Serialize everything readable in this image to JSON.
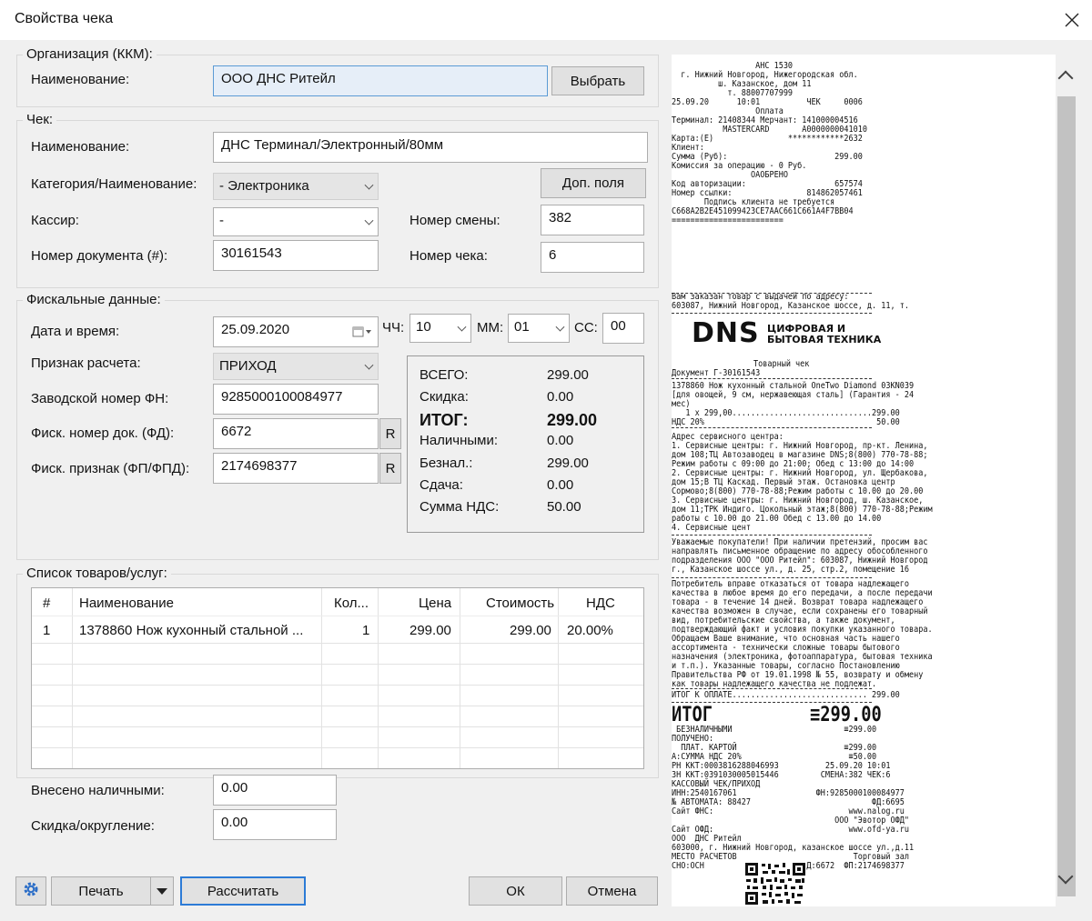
{
  "window": {
    "title": "Свойства чека"
  },
  "kkm": {
    "group_label": "Организация (ККМ):",
    "name_label": "Наименование:",
    "name_value": "ООО  ДНС Ритейл",
    "select_button": "Выбрать"
  },
  "check": {
    "group_label": "Чек:",
    "name_label": "Наименование:",
    "name_value": "ДНС Терминал/Электронный/80мм",
    "category_label": "Категория/Наименование:",
    "category_value": "- Электроника",
    "extra_button": "Доп. поля",
    "cashier_label": "Кассир:",
    "cashier_value": "-",
    "shift_label": "Номер смены:",
    "shift_value": "382",
    "doc_label": "Номер документа (#):",
    "doc_value": "30161543",
    "check_num_label": "Номер чека:",
    "check_num_value": "6"
  },
  "fiscal": {
    "group_label": "Фискальные данные:",
    "date_label": "Дата и время:",
    "date_value": "25.09.2020",
    "hh_label": "ЧЧ:",
    "hh_value": "10",
    "mm_label": "ММ:",
    "mm_value": "01",
    "ss_label": "СС:",
    "ss_value": "00",
    "calc_label": "Признак расчета:",
    "calc_value": "ПРИХОД",
    "fn_label": "Заводской номер ФН:",
    "fn_value": "9285000100084977",
    "fd_label": "Фиск. номер док. (ФД):",
    "fd_value": "6672",
    "fp_label": "Фиск. признак (ФП/ФПД):",
    "fp_value": "2174698377",
    "r_button": "R"
  },
  "totals": {
    "total_label": "ВСЕГО:",
    "total_value": "299.00",
    "discount_label": "Скидка:",
    "discount_value": "0.00",
    "itog_label": "ИТОГ:",
    "itog_value": "299.00",
    "cash_label": "Наличными:",
    "cash_value": "0.00",
    "card_label": "Безнал.:",
    "card_value": "299.00",
    "change_label": "Сдача:",
    "change_value": "0.00",
    "vat_label": "Сумма НДС:",
    "vat_value": "50.00"
  },
  "goods": {
    "group_label": "Список товаров/услуг:",
    "columns": [
      "#",
      "Наименование",
      "Кол...",
      "Цена",
      "Стоимость",
      "НДС"
    ],
    "rows": [
      [
        "1",
        "1378860 Нож кухонный стальной ...",
        "1",
        "299.00",
        "299.00",
        "20.00%"
      ]
    ]
  },
  "bottom": {
    "cash_in_label": "Внесено наличными:",
    "cash_in_value": "0.00",
    "rounding_label": "Скидка/округление:",
    "rounding_value": "0.00",
    "print_button": "Печать",
    "calc_button": "Рассчитать",
    "ok_button": "ОК",
    "cancel_button": "Отмена"
  },
  "receipt": {
    "slip_lines": [
      "                  АНС 1530",
      "  г. Нижний Новгород, Нижегородская обл.",
      "          ш. Казанское, дом 11",
      "            т. 88007707999",
      "25.09.20      10:01          ЧЕК     0006",
      "                  Оплата",
      "Терминал: 21408344 Мерчант: 141000004516",
      "           MASTERCARD       A0000000041010",
      "Карта:(E)                ************2632",
      "Клиент:",
      "Сумма (Руб):                       299.00",
      "Комиссия за операцию - 0 Руб.",
      "                 ОАОБРЕНО",
      "Код авторизации:                   657574",
      "Номер ссылки:                814862057461",
      "       Подпись клиента не требуется",
      "C668A2B2E451099423CE7AAC661C661A4F7BB04",
      "========================"
    ],
    "address_lines": [
      "Вам заказан товар с выдачей по адресу:",
      "603087, Нижний Новгород, Казанское шоссе, д. 11, т."
    ],
    "logo_text": "DNS",
    "logo_sub": [
      "ЦИФРОВАЯ И",
      "БЫТОВАЯ ТЕХНИКА"
    ],
    "check_title": "Товарный чек",
    "doc_line": "Документ Г-30161543",
    "item_lines": [
      "1378860 Нож кухонный стальной OneTwo Diamond 03KN039",
      "[для овощей, 9 см, нержавеющая сталь] (Гарантия - 24",
      "мес)",
      "   1 x 299,00..............................299.00",
      "НДС 20%                                     50.00"
    ],
    "service_lines": [
      "Адрес сервисного центра:",
      "1. Сервисные центры: г. Нижний Новгород, пр-кт. Ленина,",
      "дом 108;ТЦ Автозаводец в магазине DNS;8(800) 770-78-88;",
      "Режим работы с 09:00 до 21:00; Обед с 13:00 до 14:00",
      "2. Сервисные центры: г. Нижний Новгород, ул. Щербакова,",
      "дом 15;В ТЦ Каскад. Первый этаж. Остановка центр",
      "Сормово;8(800) 770-78-88;Режим работы с 10.00 до 20.00",
      "3. Сервисные центры: г. Нижний Новгород, ш. Казанское,",
      "дом 11;ТРК Индиго. Цокольный этаж;8(800) 770-78-88;Режим",
      "работы с 10.00 до 21.00 Обед с 13.00 до 14.00",
      "4. Сервисные цент"
    ],
    "notice_lines": [
      "Уважаемые покупатели! При наличии претензий, просим вас",
      "направлять письменное обращение по адресу обособленного",
      "подразделения ООО \"ООО Ритейл\": 603087, Нижний Новгород",
      "г., Казанское шоссе ул., д. 25, стр.2, помещение 16"
    ],
    "return_lines": [
      "Потребитель вправе отказаться от товара надлежащего",
      "качества в любое время до его передачи, а после передачи",
      "товара - в течение 14 дней. Возврат товара надлежащего",
      "качества возможен в случае, если сохранены его товарный",
      "вид, потребительские свойства, а также документ,",
      "подтверждающий факт и условия покупки указанного товара.",
      "Обращаем Ваше внимание, что основная часть нашего",
      "ассортимента - технически сложные товары бытового",
      "назначения (электроника, фотоаппаратура, бытовая техника",
      "и т.п.). Указанные товары, согласно Постановлению",
      "Правительства РФ от 19.01.1998 № 55, возврату и обмену",
      "как товары надлежащего качества не подлежат."
    ],
    "to_pay_line": "ИТОГ К ОПЛАТЕ............................. 299.00",
    "itog_label": "ИТОГ",
    "itog_value": "≡299.00",
    "fiscal_lines": [
      " БЕЗНАЛИЧНЫМИ                        ≡299.00",
      "ПОЛУЧЕНО:",
      "  ПЛАТ. КАРТОЙ                       ≡299.00",
      "А:СУММА НДС 20%                       ≡50.00",
      "РН ККТ:0003816288046993          25.09.20 10:01",
      "ЗН ККТ:0391030005015446         СМЕНА:382 ЧЕК:6",
      "КАССОВЫЙ ЧЕК/ПРИХОД",
      "ИНН:2540167061                 ФН:9285000100084977",
      "№ АВТОМАТА: 88427                          ФД:6695",
      "Сайт ФНС:                             www.nalog.ru",
      "                                   ООО \"Эвотор ОФД\"",
      "Сайт ОФД:                             www.ofd-ya.ru",
      "ООО  ДНС Ритейл",
      "603000, г. Нижний Новгород, казанское шоссе ул.,д.11",
      "МЕСТО РАСЧЕТОВ                         Торговый зал",
      "СНО:ОСН                     ФД:6672  ФП:2174698377"
    ]
  }
}
